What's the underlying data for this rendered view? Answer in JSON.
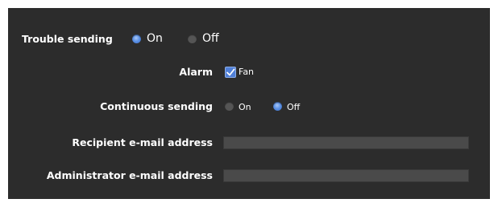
{
  "trouble_sending": {
    "label": "Trouble sending",
    "on_label": "On",
    "off_label": "Off",
    "selected": "On"
  },
  "alarm": {
    "label": "Alarm",
    "checkbox_label": "Fan",
    "checked": true
  },
  "continuous_sending": {
    "label": "Continuous sending",
    "on_label": "On",
    "off_label": "Off",
    "selected": "Off"
  },
  "recipient": {
    "label": "Recipient e-mail address",
    "value": ""
  },
  "administrator": {
    "label": "Administrator e-mail address",
    "value": ""
  },
  "colors": {
    "panel": "#2c2c2c",
    "accent": "#5e93e6",
    "field": "#4a4a4a"
  }
}
